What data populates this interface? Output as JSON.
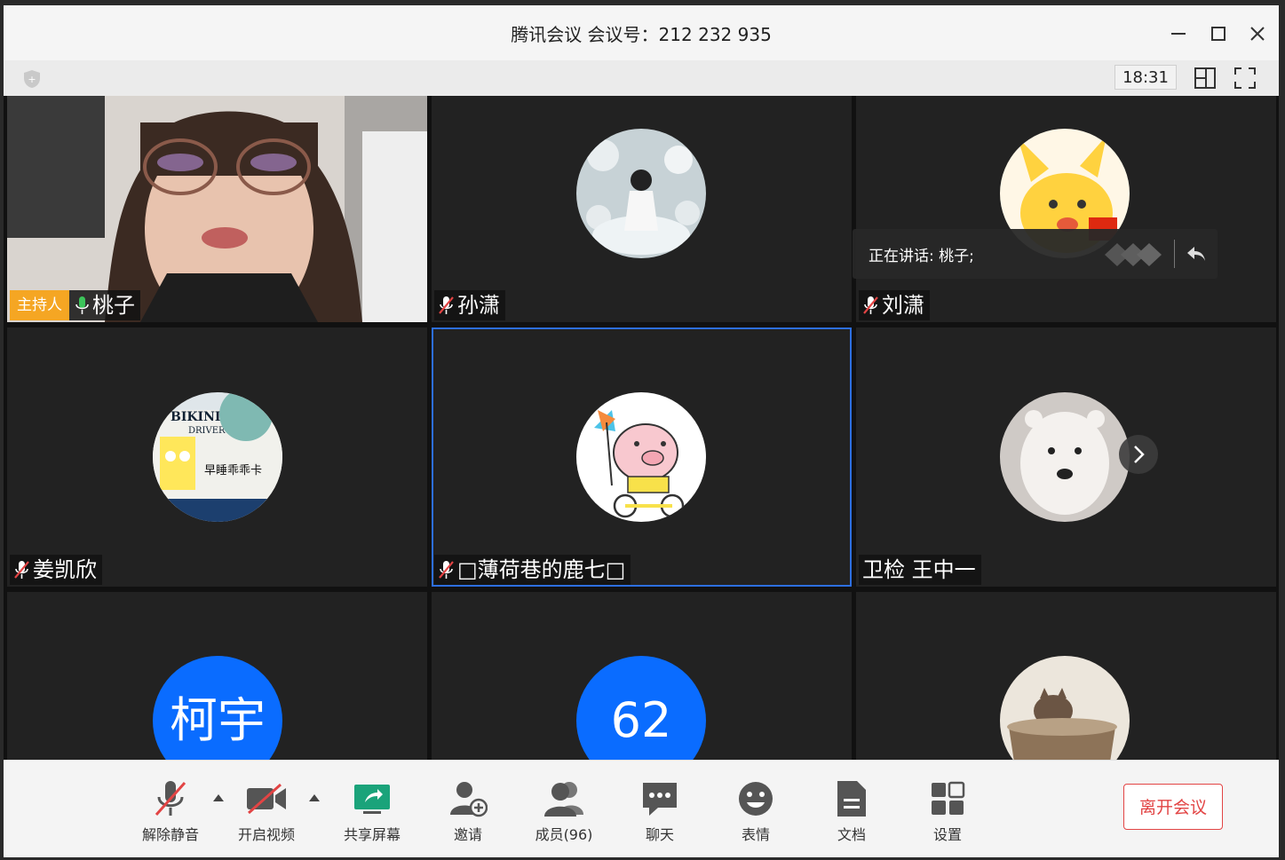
{
  "window": {
    "title": "腾讯会议 会议号：212 232 935",
    "time": "18:31"
  },
  "speaking": {
    "text": "正在讲话: 桃子;"
  },
  "participants": [
    {
      "name": "桃子",
      "role": "主持人",
      "mic": "on",
      "kind": "video"
    },
    {
      "name": "孙潇",
      "mic": "muted",
      "kind": "avatar"
    },
    {
      "name": "刘潇",
      "mic": "muted",
      "kind": "avatar"
    },
    {
      "name": "姜凯欣",
      "mic": "muted",
      "kind": "avatar",
      "avatar_text": "早睡乖乖卡"
    },
    {
      "name": "□薄荷巷的鹿七□",
      "mic": "muted",
      "kind": "avatar"
    },
    {
      "name": "卫检 王中一",
      "mic": "none",
      "kind": "avatar"
    },
    {
      "initials": "柯宇",
      "kind": "initials"
    },
    {
      "initials": "62",
      "kind": "initials"
    },
    {
      "kind": "avatar"
    }
  ],
  "bottom_bar": {
    "mute": "解除静音",
    "video": "开启视频",
    "share": "共享屏幕",
    "invite": "邀请",
    "members": "成员(96)",
    "chat": "聊天",
    "emoji": "表情",
    "docs": "文档",
    "settings": "设置",
    "leave": "离开会议"
  },
  "colors": {
    "accent": "#0a6cff",
    "host_badge": "#f5a623",
    "leave": "#e24444",
    "share_icon": "#1aa37a",
    "tile_bg": "#222222"
  }
}
